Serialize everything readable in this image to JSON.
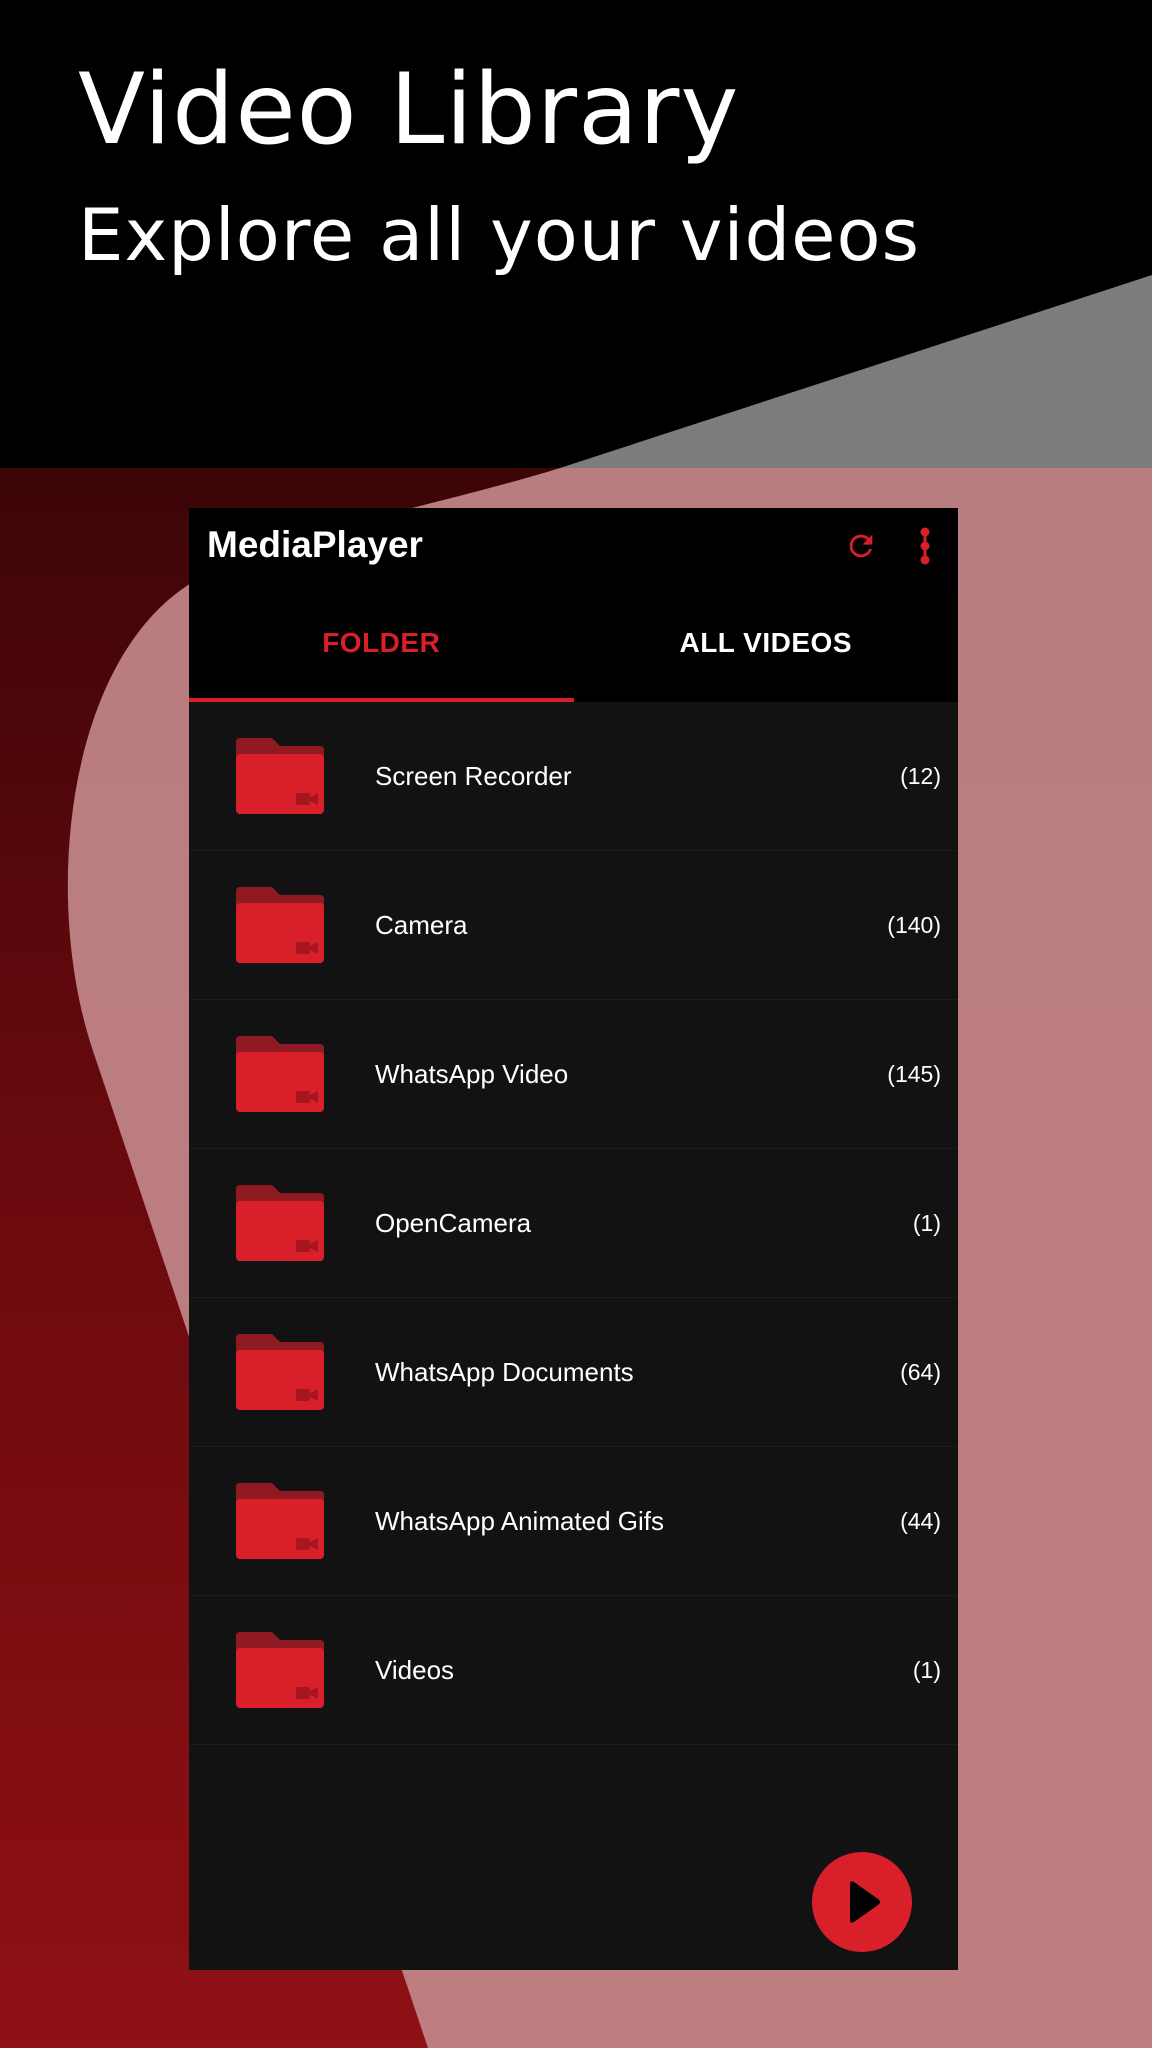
{
  "promo": {
    "title": "Video Library",
    "subtitle": "Explore all your videos"
  },
  "app": {
    "title": "MediaPlayer",
    "accent_color": "#d81f2a",
    "icons": {
      "refresh": "refresh-icon",
      "more": "more-vert-icon",
      "folder": "video-folder-icon",
      "play": "play-icon"
    }
  },
  "tabs": [
    {
      "label": "FOLDER",
      "selected": true
    },
    {
      "label": "ALL VIDEOS",
      "selected": false
    }
  ],
  "folders": [
    {
      "name": "Screen Recorder",
      "count": "(12)"
    },
    {
      "name": "Camera",
      "count": "(140)"
    },
    {
      "name": "WhatsApp Video",
      "count": "(145)"
    },
    {
      "name": "OpenCamera",
      "count": "(1)"
    },
    {
      "name": "WhatsApp Documents",
      "count": "(64)"
    },
    {
      "name": "WhatsApp Animated Gifs",
      "count": "(44)"
    },
    {
      "name": "Videos",
      "count": "(1)"
    }
  ]
}
